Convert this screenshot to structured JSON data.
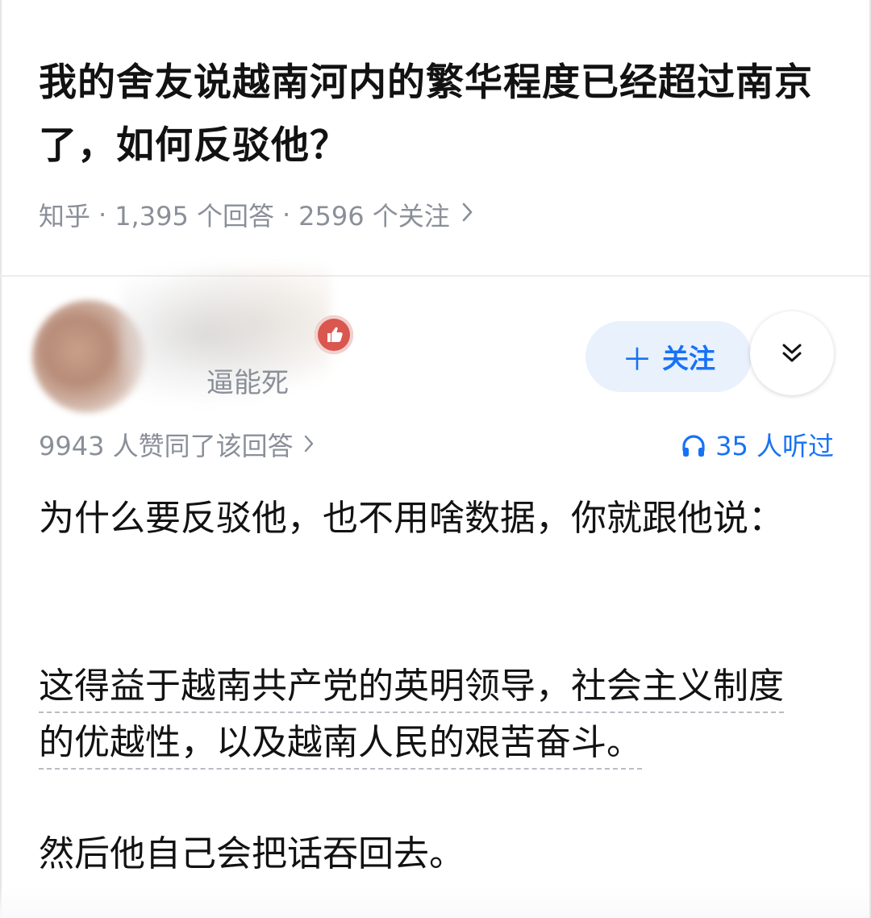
{
  "question": {
    "title": "我的舍友说越南河内的繁华程度已经超过南京了，如何反驳他？",
    "source": "知乎",
    "answers_count": "1,395 个回答",
    "followers_count": "2596 个关注",
    "separator": "·"
  },
  "author": {
    "headline": "逼能死",
    "badge_icon": "thumbs-up-icon",
    "follow_label": "关注",
    "follow_icon": "plus",
    "more_icon": "chevron-double-down-icon"
  },
  "answer_meta": {
    "votes": "9943 人赞同了该回答",
    "listeners": "35 人听过",
    "listen_icon": "headphones-icon"
  },
  "answer": {
    "para1": "为什么要反驳他，也不用啥数据，你就跟他说：",
    "para2": "这得益于越南共产党的英明领导，社会主义制度的优越性，以及越南人民的艰苦奋斗。",
    "para3": "然后他自己会把话吞回去。"
  },
  "colors": {
    "accent": "#1772f6",
    "follow_bg": "#e9f1fc",
    "meta_gray": "#8a8f99",
    "badge_red": "#d9574e"
  }
}
